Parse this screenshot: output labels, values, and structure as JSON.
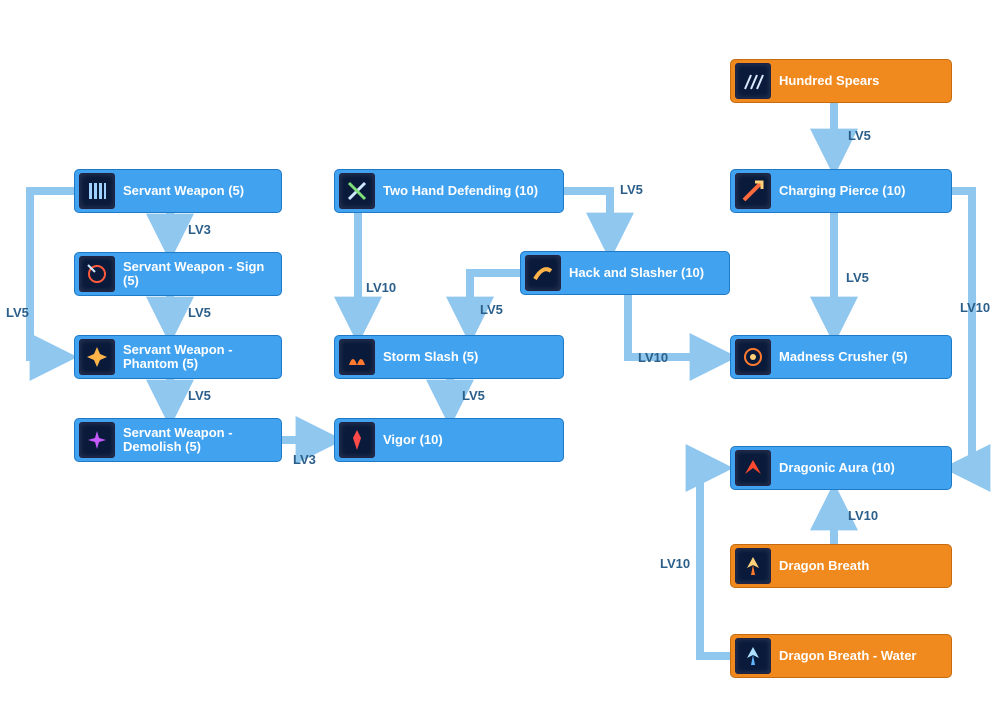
{
  "skills": {
    "servant_weapon": {
      "label": "Servant Weapon (5)",
      "color": "blue",
      "icon": "bars"
    },
    "servant_sign": {
      "label": "Servant Weapon - Sign (5)",
      "color": "blue",
      "icon": "target"
    },
    "servant_phantom": {
      "label": "Servant Weapon - Phantom (5)",
      "color": "blue",
      "icon": "burst"
    },
    "servant_demolish": {
      "label": "Servant Weapon - Demolish (5)",
      "color": "blue",
      "icon": "explode"
    },
    "two_hand_def": {
      "label": "Two Hand Defending (10)",
      "color": "blue",
      "icon": "cross"
    },
    "hack_slasher": {
      "label": "Hack and Slasher (10)",
      "color": "blue",
      "icon": "slash"
    },
    "storm_slash": {
      "label": "Storm Slash (5)",
      "color": "blue",
      "icon": "flame"
    },
    "vigor": {
      "label": "Vigor (10)",
      "color": "blue",
      "icon": "vigor"
    },
    "hundred_spears": {
      "label": "Hundred Spears",
      "color": "orange",
      "icon": "spears"
    },
    "charging_pierce": {
      "label": "Charging Pierce (10)",
      "color": "blue",
      "icon": "pierce"
    },
    "madness_crusher": {
      "label": "Madness Crusher (5)",
      "color": "blue",
      "icon": "swirl"
    },
    "dragonic_aura": {
      "label": "Dragonic Aura (10)",
      "color": "blue",
      "icon": "dragon"
    },
    "dragon_breath": {
      "label": "Dragon Breath",
      "color": "orange",
      "icon": "dbreath"
    },
    "dragon_breath_water": {
      "label": "Dragon Breath - Water",
      "color": "orange",
      "icon": "dbreath"
    }
  },
  "edge_labels": {
    "sw_to_sign": "LV3",
    "sign_to_phantom": "LV5",
    "phantom_to_demo": "LV5",
    "sw_to_phantom": "LV5",
    "demo_to_vigor": "LV3",
    "thd_to_hack": "LV5",
    "thd_to_storm": "LV10",
    "hack_to_storm": "LV5",
    "storm_to_vigor": "LV5",
    "hack_to_madness": "LV10",
    "hs_to_cp": "LV5",
    "cp_to_madness": "LV5",
    "cp_to_aura": "LV10",
    "db_to_aura": "LV10",
    "dbw_to_aura": "LV10"
  }
}
